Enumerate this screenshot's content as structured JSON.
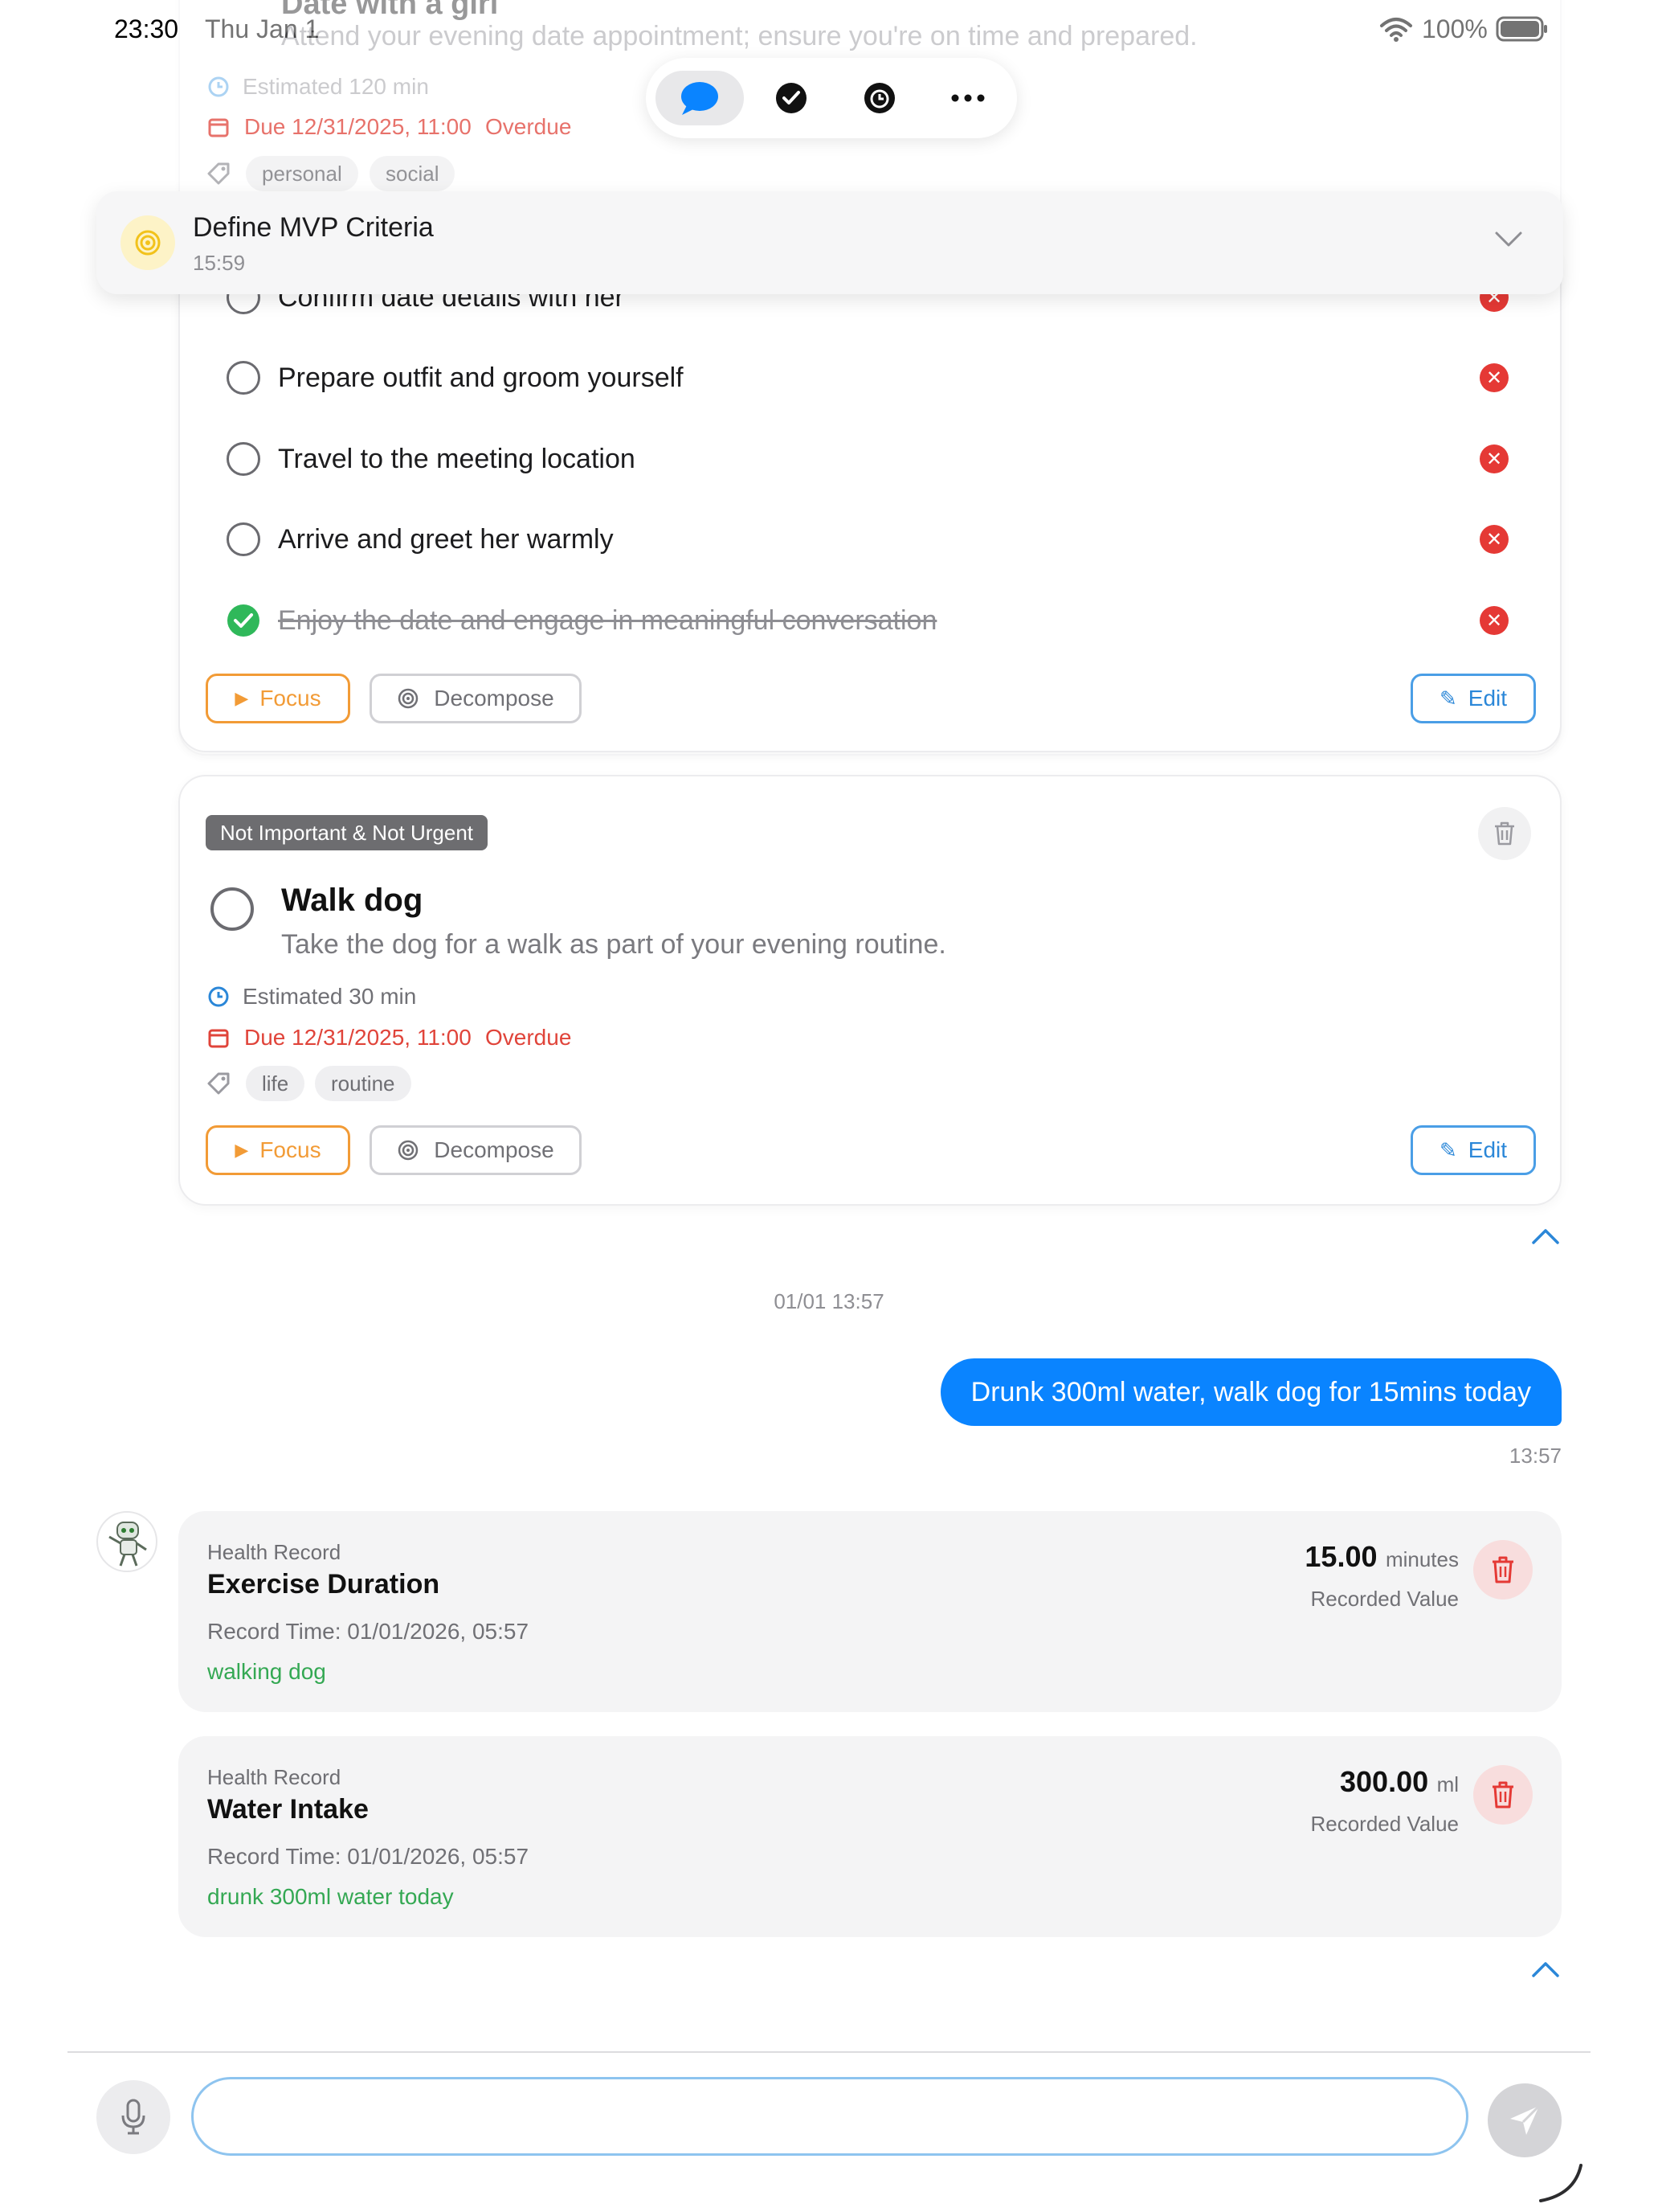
{
  "status_bar": {
    "time": "23:30",
    "date": "Thu Jan 1",
    "battery": "100%"
  },
  "top_card": {
    "title": "Date with a girl",
    "description": "Attend your evening date appointment; ensure you're on time and prepared.",
    "estimated": "Estimated 120 min",
    "due": "Due 12/31/2025, 11:00",
    "overdue": "Overdue",
    "tags": [
      "personal",
      "social"
    ]
  },
  "focus_banner": {
    "title": "Define MVP Criteria",
    "time": "15:59"
  },
  "subtasks": [
    {
      "text": "Confirm date details with her",
      "done": false
    },
    {
      "text": "Prepare outfit and groom yourself",
      "done": false
    },
    {
      "text": "Travel to the meeting location",
      "done": false
    },
    {
      "text": "Arrive and greet her warmly",
      "done": false
    },
    {
      "text": "Enjoy the date and engage in meaningful conversation",
      "done": true
    }
  ],
  "actions": {
    "focus": "Focus",
    "decompose": "Decompose",
    "edit": "Edit"
  },
  "walk_card": {
    "badge": "Not Important & Not Urgent",
    "title": "Walk dog",
    "description": "Take the dog for a walk as part of your evening routine.",
    "estimated": "Estimated 30 min",
    "due": "Due 12/31/2025, 11:00",
    "overdue": "Overdue",
    "tags": [
      "life",
      "routine"
    ]
  },
  "chat": {
    "timestamp": "01/01 13:57",
    "user_message": "Drunk 300ml water, walk dog for 15mins today",
    "user_message_time": "13:57"
  },
  "health_records": [
    {
      "category": "Health Record",
      "title": "Exercise Duration",
      "record_time": "Record Time: 01/01/2026, 05:57",
      "note": "walking dog",
      "value": "15.00",
      "unit": "minutes",
      "value_label": "Recorded Value"
    },
    {
      "category": "Health Record",
      "title": "Water Intake",
      "record_time": "Record Time: 01/01/2026, 05:57",
      "note": "drunk 300ml water today",
      "value": "300.00",
      "unit": "ml",
      "value_label": "Recorded Value"
    }
  ],
  "input": {
    "placeholder": ""
  },
  "colors": {
    "accent_blue": "#0a84ff",
    "overdue_red": "#e0443a",
    "focus_orange": "#f29b36",
    "note_green": "#34a853"
  },
  "icons": {
    "toolbar": [
      "chat-bubble-icon",
      "checkmark-circle-icon",
      "timer-icon",
      "more-icon"
    ],
    "input": [
      "microphone-icon",
      "send-icon"
    ]
  }
}
